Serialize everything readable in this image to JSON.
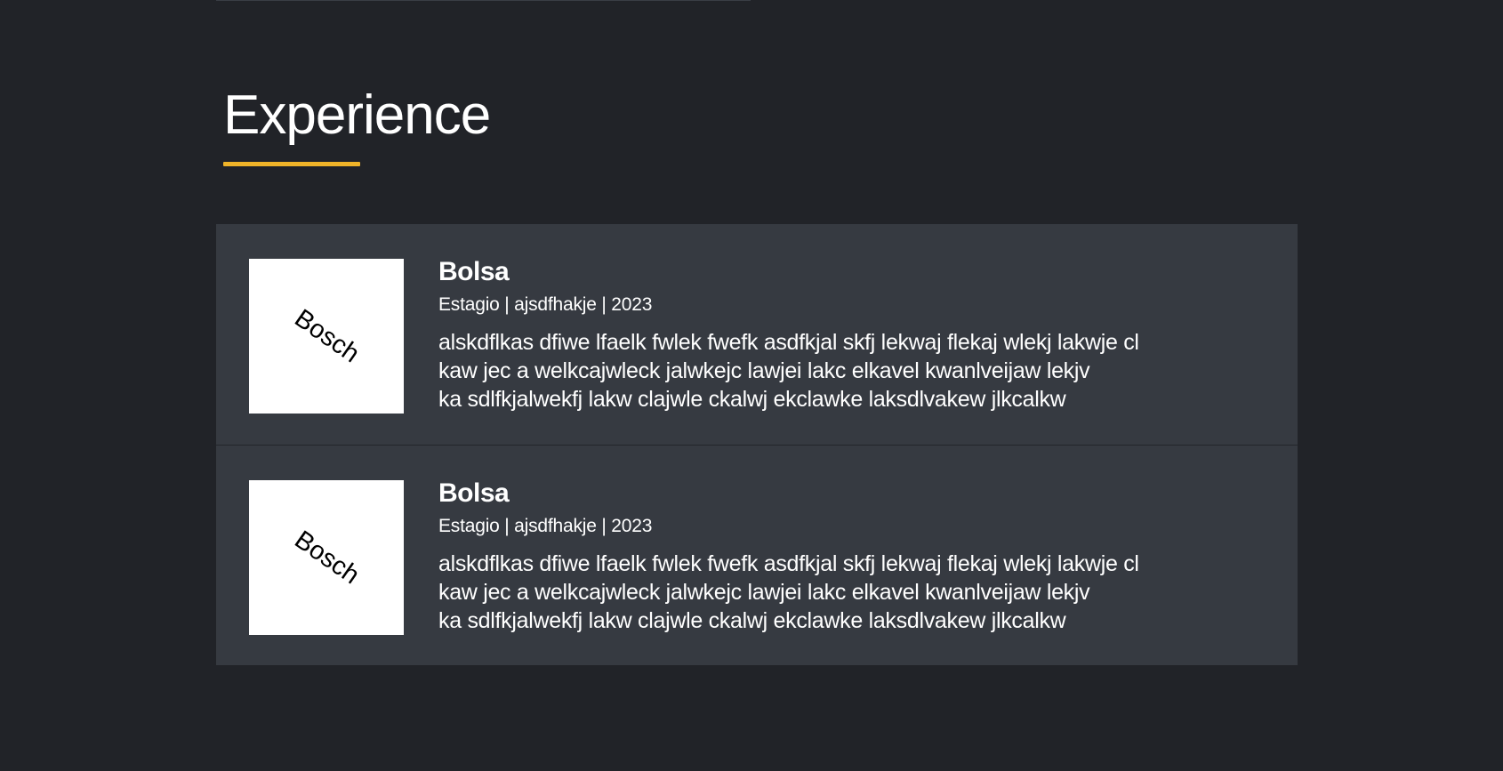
{
  "section": {
    "title": "Experience",
    "accent_color": "#f0b429"
  },
  "experience": [
    {
      "logo_text": "Bosch",
      "title": "Bolsa",
      "meta": "Estagio | ajsdfhakje | 2023",
      "description_lines": [
        "alskdflkas dfiwe lfaelk fwlek fwefk asdfkjal skfj lekwaj flekaj wlekj lakwje cl",
        "kaw jec a welkcajwleck jalwkejc lawjei lakc elkavel kwanlveijaw lekjv",
        "ka sdlfkjalwekfj lakw clajwle ckalwj ekclawke laksdlvakew jlkcalkw"
      ]
    },
    {
      "logo_text": "Bosch",
      "title": "Bolsa",
      "meta": "Estagio | ajsdfhakje | 2023",
      "description_lines": [
        "alskdflkas dfiwe lfaelk fwlek fwefk asdfkjal skfj lekwaj flekaj wlekj lakwje cl",
        "kaw jec a welkcajwleck jalwkejc lawjei lakc elkavel kwanlveijaw lekjv",
        "ka sdlfkjalwekfj lakw clajwle ckalwj ekclawke laksdlvakew jlkcalkw"
      ]
    }
  ]
}
